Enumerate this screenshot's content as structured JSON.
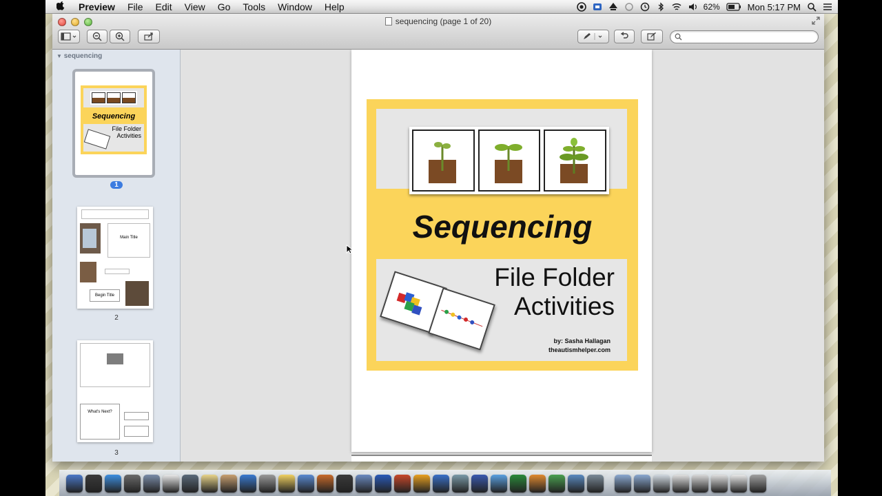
{
  "menubar": {
    "app": "Preview",
    "items": [
      "File",
      "Edit",
      "View",
      "Go",
      "Tools",
      "Window",
      "Help"
    ],
    "battery": "62%",
    "clock": "Mon 5:17 PM"
  },
  "window": {
    "title": "sequencing (page 1 of 20)",
    "search_placeholder": ""
  },
  "sidebar": {
    "header": "sequencing",
    "pages": [
      {
        "label": "1",
        "selected": true,
        "title": "Sequencing",
        "subtitle1": "File Folder",
        "subtitle2": "Activities"
      },
      {
        "label": "2",
        "selected": false,
        "box1": "Main Title",
        "box2": "Begin Title"
      },
      {
        "label": "3",
        "selected": false,
        "box1": "What's Next?"
      }
    ]
  },
  "document": {
    "title": "Sequencing",
    "subtitle_line1": "File Folder",
    "subtitle_line2": "Activities",
    "byline": "by: Sasha Hallagan",
    "website": "theautismhelper.com"
  },
  "colors": {
    "cover_yellow": "#fbd45a",
    "sidebar_bg": "#dfe5ed",
    "selection_blue": "#3c7ce0"
  },
  "dock_icons": [
    "finder-icon",
    "dashboard-icon",
    "safari-icon",
    "mission-control-icon",
    "preview-icon",
    "calendar-icon",
    "facetime-icon",
    "notes-icon",
    "address-book-icon",
    "itunes-icon",
    "trash-can-icon",
    "stickies-icon",
    "photo-icon",
    "garageband-icon",
    "photobooth-icon",
    "keynote-icon",
    "word-icon",
    "powerpoint-icon",
    "outlook-icon",
    "downloads-icon",
    "utilities-icon",
    "quicktime-icon",
    "messages-icon",
    "excel-icon",
    "firefox-icon",
    "chrome-icon",
    "iphoto-icon",
    "network-icon",
    "folder-icon",
    "folder-icon",
    "mail-icon",
    "doc-icon",
    "doc-icon",
    "doc-icon",
    "doc-icon",
    "trash-icon"
  ]
}
